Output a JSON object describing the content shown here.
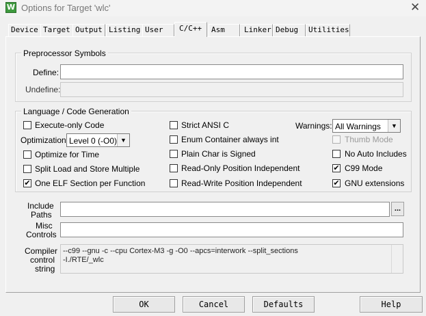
{
  "window": {
    "title": "Options for Target 'wlc'",
    "icon_letter": "W"
  },
  "tabs": [
    "Device",
    "Target",
    "Output",
    "Listing",
    "User",
    "C/C++",
    "Asm",
    "Linker",
    "Debug",
    "Utilities"
  ],
  "active_tab": "C/C++",
  "preprocessor": {
    "legend": "Preprocessor Symbols",
    "define_label": "Define:",
    "define_value": "",
    "undefine_label": "Undefine:",
    "undefine_value": ""
  },
  "language": {
    "legend": "Language / Code Generation",
    "execute_only": {
      "label": "Execute-only Code",
      "checked": false
    },
    "optimization_label": "Optimization:",
    "optimization_value": "Level 0 (-O0)",
    "optimize_time": {
      "label": "Optimize for Time",
      "checked": false
    },
    "split_load": {
      "label": "Split Load and Store Multiple",
      "checked": false
    },
    "one_elf": {
      "label": "One ELF Section per Function",
      "checked": true,
      "mark": "✔"
    },
    "strict_ansi": {
      "label": "Strict ANSI C",
      "checked": false
    },
    "enum_container": {
      "label": "Enum Container always int",
      "checked": false
    },
    "plain_char": {
      "label": "Plain Char is Signed",
      "checked": false
    },
    "ro_pos": {
      "label": "Read-Only Position Independent",
      "checked": false
    },
    "rw_pos": {
      "label": "Read-Write Position Independent",
      "checked": false
    },
    "warnings_label": "Warnings:",
    "warnings_value": "All Warnings",
    "thumb_mode": {
      "label": "Thumb Mode",
      "checked": false,
      "disabled": true
    },
    "no_auto_includes": {
      "label": "No Auto Includes",
      "checked": false
    },
    "c99_mode": {
      "label": "C99 Mode",
      "checked": true,
      "mark": "✔"
    },
    "gnu_ext": {
      "label": "GNU extensions",
      "checked": true,
      "mark": "✔"
    }
  },
  "include_paths": {
    "label_line1": "Include",
    "label_line2": "Paths",
    "value": "",
    "browse_label": "..."
  },
  "misc_controls": {
    "label_line1": "Misc",
    "label_line2": "Controls",
    "value": ""
  },
  "compiler_string": {
    "label_line1": "Compiler",
    "label_line2": "control",
    "label_line3": "string",
    "line1": "--c99 --gnu -c --cpu Cortex-M3 -g -O0 --apcs=interwork --split_sections",
    "line2": "-I./RTE/_wlc"
  },
  "buttons": {
    "ok": "OK",
    "cancel": "Cancel",
    "defaults": "Defaults",
    "help": "Help"
  }
}
